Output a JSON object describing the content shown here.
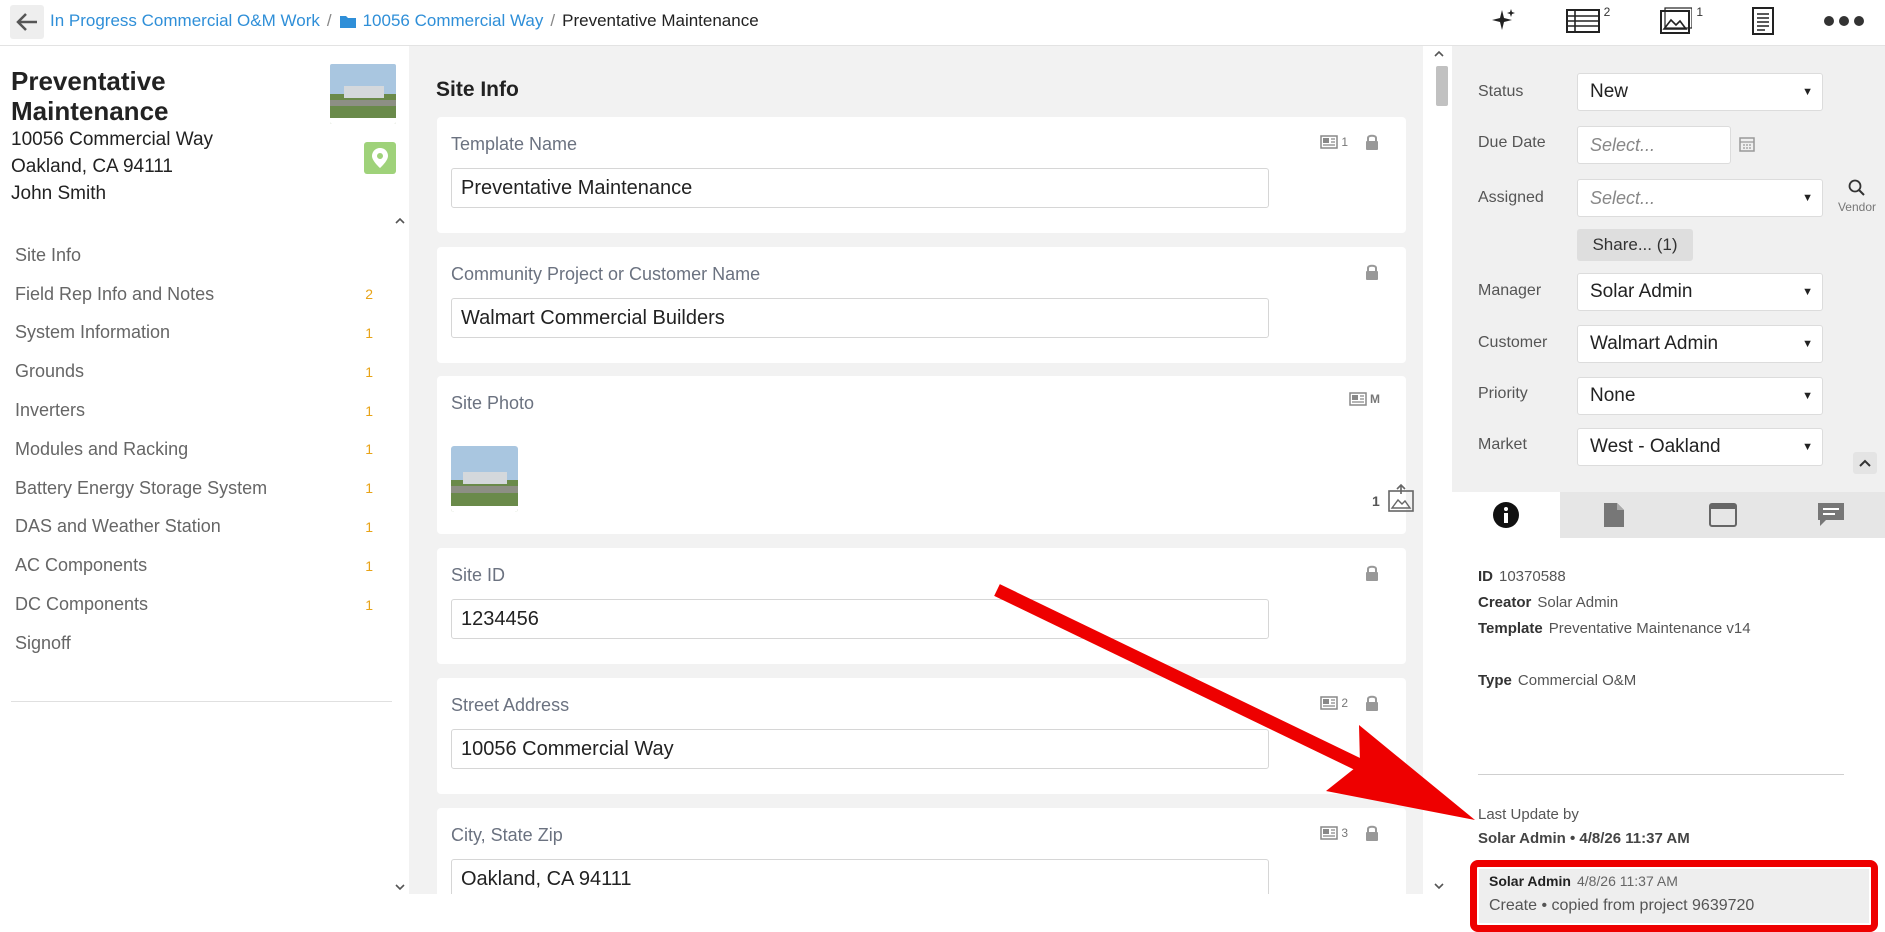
{
  "breadcrumb": {
    "items": [
      "In Progress Commercial O&M Work",
      "10056 Commercial Way"
    ],
    "current": "Preventative Maintenance"
  },
  "toolbar": {
    "table_count": "2",
    "photo_count": "1"
  },
  "summary": {
    "title": "Preventative Maintenance",
    "street": "10056 Commercial Way",
    "city": "Oakland, CA 94111",
    "contact": "John Smith"
  },
  "sections": [
    {
      "label": "Site Info",
      "count": ""
    },
    {
      "label": "Field Rep Info and Notes",
      "count": "2"
    },
    {
      "label": "System Information",
      "count": "1"
    },
    {
      "label": "Grounds",
      "count": "1"
    },
    {
      "label": "Inverters",
      "count": "1"
    },
    {
      "label": "Modules and Racking",
      "count": "1"
    },
    {
      "label": "Battery Energy Storage System",
      "count": "1"
    },
    {
      "label": "DAS and Weather Station",
      "count": "1"
    },
    {
      "label": "AC Components",
      "count": "1"
    },
    {
      "label": "DC Components",
      "count": "1"
    },
    {
      "label": "Signoff",
      "count": ""
    }
  ],
  "form": {
    "title": "Site Info",
    "template_name": {
      "label": "Template Name",
      "value": "Preventative Maintenance",
      "badge": "1"
    },
    "customer": {
      "label": "Community Project or Customer Name",
      "value": "Walmart Commercial Builders"
    },
    "site_photo": {
      "label": "Site Photo",
      "badge": "M",
      "count": "1"
    },
    "site_id": {
      "label": "Site ID",
      "value": "1234456"
    },
    "street": {
      "label": "Street Address",
      "value": "10056 Commercial Way",
      "badge": "2"
    },
    "city": {
      "label": "City, State Zip",
      "value": "Oakland, CA 94111",
      "badge": "3"
    }
  },
  "details": {
    "status_label": "Status",
    "status": "New",
    "due_label": "Due Date",
    "due_placeholder": "Select...",
    "assigned_label": "Assigned",
    "assigned_placeholder": "Select...",
    "vendor": "Vendor",
    "share": "Share... (1)",
    "manager_label": "Manager",
    "manager": "Solar Admin",
    "customer_label": "Customer",
    "customer": "Walmart Admin",
    "priority_label": "Priority",
    "priority": "None",
    "market_label": "Market",
    "market": "West - Oakland"
  },
  "info": {
    "id_label": "ID",
    "id": "10370588",
    "creator_label": "Creator",
    "creator": "Solar Admin",
    "template_label": "Template",
    "template": "Preventative Maintenance v14",
    "type_label": "Type",
    "type": "Commercial O&M",
    "last_update_label": "Last Update by",
    "last_update": "Solar Admin • 4/8/26 11:37 AM"
  },
  "activity": {
    "user": "Solar Admin",
    "time": "4/8/26 11:37 AM",
    "action": "Create • copied from project 9639720"
  },
  "colors": {
    "link": "#2f8fd8",
    "badge": "#e8a317",
    "highlight": "#ee0000"
  }
}
